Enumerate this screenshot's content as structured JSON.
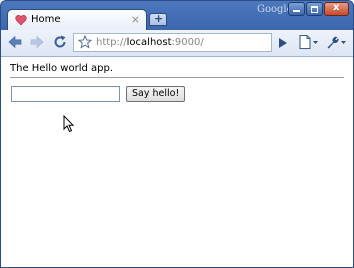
{
  "browser": {
    "tab_title": "Home",
    "tab_close": "×",
    "new_tab": "+",
    "brand": "Google",
    "window_close": "x",
    "url_scheme": "http://",
    "url_host": "localhost",
    "url_port": ":9000/"
  },
  "page": {
    "intro_text": "The Hello world app.",
    "name_input_value": "",
    "say_hello_label": "Say hello!"
  },
  "colors": {
    "frame": "#3f69b0",
    "toolbar": "#dbe5f4"
  }
}
